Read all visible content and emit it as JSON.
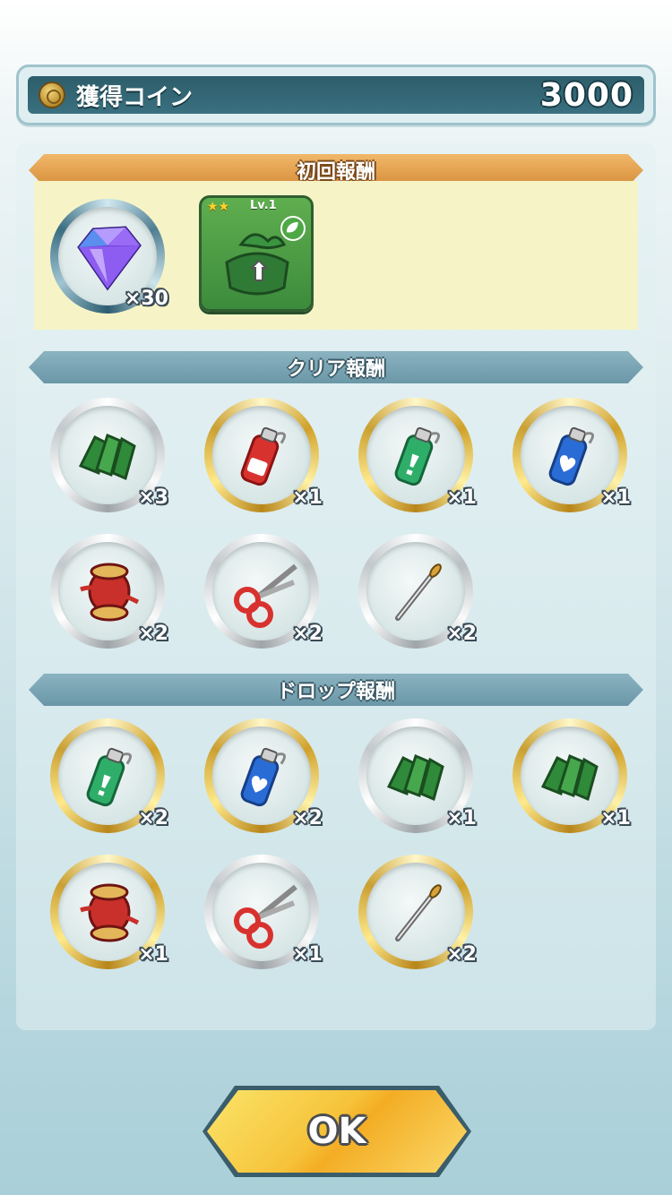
{
  "coin": {
    "label": "獲得コイン",
    "value": "3000",
    "icon": "coin-icon"
  },
  "sections": {
    "first": {
      "title": "初回報酬"
    },
    "clear": {
      "title": "クリア報酬"
    },
    "drop": {
      "title": "ドロップ報酬"
    }
  },
  "first_rewards": {
    "gem": {
      "icon": "gem-icon",
      "qty": "×30"
    },
    "card": {
      "icon": "bandana-card-icon",
      "stars": "★★",
      "level": "Lv.1",
      "badge": "leaf-icon"
    }
  },
  "clear_rewards": [
    {
      "icon": "green-cloth-icon",
      "qty": "×3",
      "ring": "silver"
    },
    {
      "icon": "red-bottle-icon",
      "qty": "×1",
      "ring": "gold"
    },
    {
      "icon": "green-bottle-icon",
      "qty": "×1",
      "ring": "gold"
    },
    {
      "icon": "blue-bottle-icon",
      "qty": "×1",
      "ring": "gold"
    },
    {
      "icon": "thread-spool-icon",
      "qty": "×2",
      "ring": "silver"
    },
    {
      "icon": "scissors-icon",
      "qty": "×2",
      "ring": "silver"
    },
    {
      "icon": "needle-icon",
      "qty": "×2",
      "ring": "silver"
    }
  ],
  "drop_rewards": [
    {
      "icon": "green-bottle-icon",
      "qty": "×2",
      "ring": "gold"
    },
    {
      "icon": "blue-bottle-icon",
      "qty": "×2",
      "ring": "gold"
    },
    {
      "icon": "green-cloth-icon",
      "qty": "×1",
      "ring": "silver"
    },
    {
      "icon": "green-cloth-icon",
      "qty": "×1",
      "ring": "gold"
    },
    {
      "icon": "thread-spool-icon",
      "qty": "×1",
      "ring": "gold"
    },
    {
      "icon": "scissors-icon",
      "qty": "×1",
      "ring": "silver"
    },
    {
      "icon": "needle-icon",
      "qty": "×2",
      "ring": "gold"
    }
  ],
  "ok_button": {
    "label": "OK"
  }
}
